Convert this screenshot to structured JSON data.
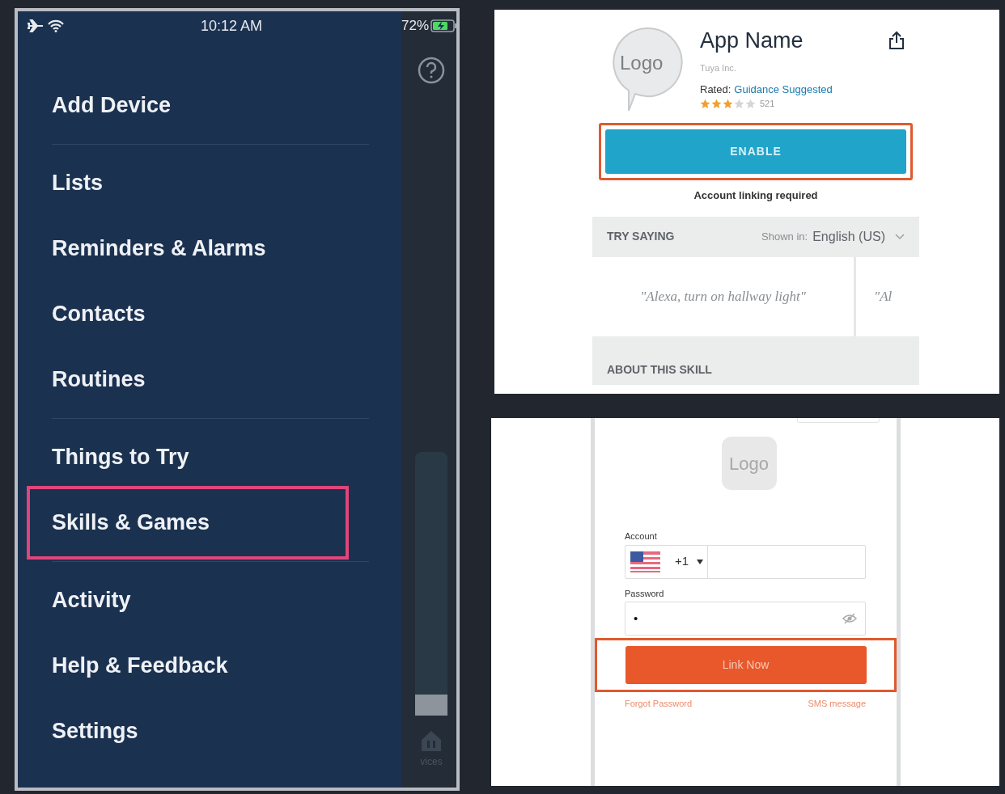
{
  "menu_screen": {
    "status_bar": {
      "time": "10:12 AM",
      "battery_percent": "72%"
    },
    "menu_items": [
      {
        "label": "Add Device",
        "highlighted": false,
        "divider_after": true
      },
      {
        "label": "Lists",
        "highlighted": false,
        "divider_after": false
      },
      {
        "label": "Reminders & Alarms",
        "highlighted": false,
        "divider_after": false
      },
      {
        "label": "Contacts",
        "highlighted": false,
        "divider_after": false
      },
      {
        "label": "Routines",
        "highlighted": false,
        "divider_after": true
      },
      {
        "label": "Things to Try",
        "highlighted": false,
        "divider_after": false
      },
      {
        "label": "Skills & Games",
        "highlighted": true,
        "divider_after": true
      },
      {
        "label": "Activity",
        "highlighted": false,
        "divider_after": false
      },
      {
        "label": "Help & Feedback",
        "highlighted": false,
        "divider_after": false
      },
      {
        "label": "Settings",
        "highlighted": false,
        "divider_after": false
      }
    ],
    "background_tab_label": "vices"
  },
  "skill_screen": {
    "logo": "Logo",
    "app_name": "App Name",
    "developer": "Tuya Inc.",
    "rated_label": "Rated:",
    "rating": "Guidance Suggested",
    "stars": 3,
    "review_count": "521",
    "enable_button": {
      "label": "ENABLE",
      "highlighted": true
    },
    "note": "Account linking required",
    "try_saying": {
      "title": "TRY SAYING",
      "shown_in_label": "Shown in:",
      "language": "English (US)",
      "utterances": [
        "\"Alexa, turn on hallway light\"",
        "\"Al"
      ]
    },
    "about_title": "ABOUT THIS SKILL"
  },
  "login_screen": {
    "logo": "Logo",
    "account_label": "Account",
    "country_code": "+1",
    "password_label": "Password",
    "password_value": "•",
    "link_button": {
      "label": "Link Now",
      "highlighted": true
    },
    "links": [
      "Forgot Password",
      "SMS message"
    ]
  }
}
